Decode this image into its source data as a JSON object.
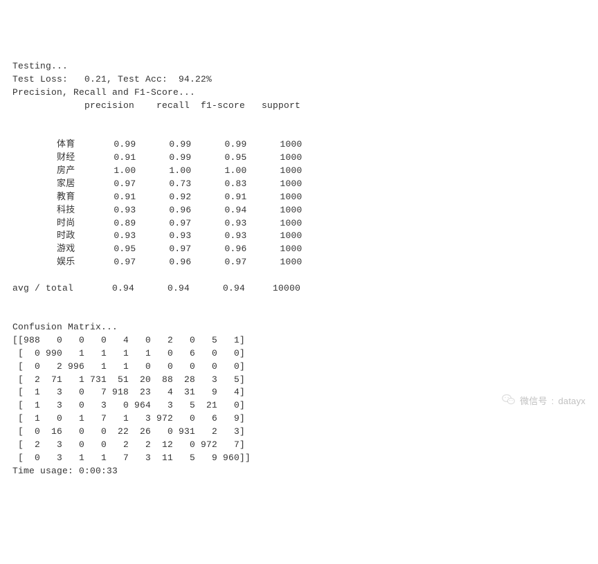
{
  "lines": {
    "testing": "Testing...",
    "test_loss": "Test Loss:   0.21, Test Acc:  94.22%",
    "pr_header": "Precision, Recall and F1-Score...",
    "avg_total": "avg / total",
    "confusion_header": "Confusion Matrix...",
    "time_usage": "Time usage: 0:00:33"
  },
  "report": {
    "columns": [
      "precision",
      "recall",
      "f1-score",
      "support"
    ],
    "rows": [
      {
        "label": "体育",
        "precision": "0.99",
        "recall": "0.99",
        "f1": "0.99",
        "support": "1000"
      },
      {
        "label": "财经",
        "precision": "0.91",
        "recall": "0.99",
        "f1": "0.95",
        "support": "1000"
      },
      {
        "label": "房产",
        "precision": "1.00",
        "recall": "1.00",
        "f1": "1.00",
        "support": "1000"
      },
      {
        "label": "家居",
        "precision": "0.97",
        "recall": "0.73",
        "f1": "0.83",
        "support": "1000"
      },
      {
        "label": "教育",
        "precision": "0.91",
        "recall": "0.92",
        "f1": "0.91",
        "support": "1000"
      },
      {
        "label": "科技",
        "precision": "0.93",
        "recall": "0.96",
        "f1": "0.94",
        "support": "1000"
      },
      {
        "label": "时尚",
        "precision": "0.89",
        "recall": "0.97",
        "f1": "0.93",
        "support": "1000"
      },
      {
        "label": "时政",
        "precision": "0.93",
        "recall": "0.93",
        "f1": "0.93",
        "support": "1000"
      },
      {
        "label": "游戏",
        "precision": "0.95",
        "recall": "0.97",
        "f1": "0.96",
        "support": "1000"
      },
      {
        "label": "娱乐",
        "precision": "0.97",
        "recall": "0.96",
        "f1": "0.97",
        "support": "1000"
      }
    ],
    "avg": {
      "precision": "0.94",
      "recall": "0.94",
      "f1": "0.94",
      "support": "10000"
    }
  },
  "confusion": [
    [
      988,
      0,
      0,
      0,
      4,
      0,
      2,
      0,
      5,
      1
    ],
    [
      0,
      990,
      1,
      1,
      1,
      1,
      0,
      6,
      0,
      0
    ],
    [
      0,
      2,
      996,
      1,
      1,
      0,
      0,
      0,
      0,
      0
    ],
    [
      2,
      71,
      1,
      731,
      51,
      20,
      88,
      28,
      3,
      5
    ],
    [
      1,
      3,
      0,
      7,
      918,
      23,
      4,
      31,
      9,
      4
    ],
    [
      1,
      3,
      0,
      3,
      0,
      964,
      3,
      5,
      21,
      0
    ],
    [
      1,
      0,
      1,
      7,
      1,
      3,
      972,
      0,
      6,
      9
    ],
    [
      0,
      16,
      0,
      0,
      22,
      26,
      0,
      931,
      2,
      3
    ],
    [
      2,
      3,
      0,
      0,
      2,
      2,
      12,
      0,
      972,
      7
    ],
    [
      0,
      3,
      1,
      1,
      7,
      3,
      11,
      5,
      9,
      960
    ]
  ],
  "footer": {
    "label": "微信号",
    "value": "datayx",
    "sep": ": "
  }
}
